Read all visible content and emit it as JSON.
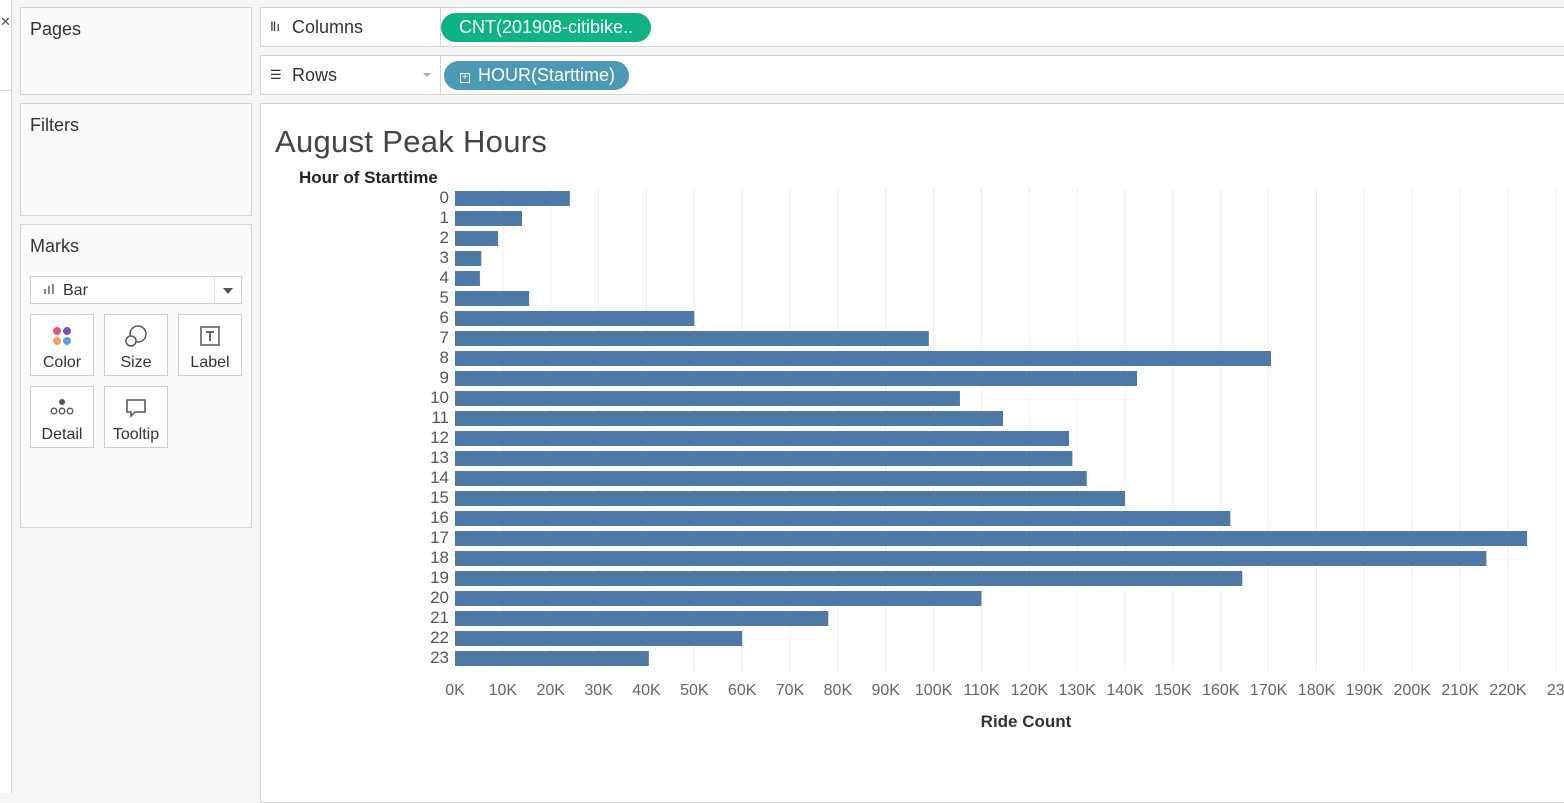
{
  "cards": {
    "pages": {
      "title": "Pages"
    },
    "filters": {
      "title": "Filters"
    },
    "marks": {
      "title": "Marks",
      "mark_type": "Bar",
      "buttons": [
        {
          "label": "Color",
          "icon": "color-icon"
        },
        {
          "label": "Size",
          "icon": "size-icon"
        },
        {
          "label": "Label",
          "icon": "label-icon"
        },
        {
          "label": "Detail",
          "icon": "detail-icon"
        },
        {
          "label": "Tooltip",
          "icon": "tooltip-icon"
        }
      ]
    }
  },
  "shelves": {
    "columns": {
      "label": "Columns",
      "pill": "CNT(201908-citibike..",
      "pill_color": "#0fb383"
    },
    "rows": {
      "label": "Rows",
      "pill": "HOUR(Starttime)",
      "pill_color": "#4b99b5"
    }
  },
  "chart_data": {
    "type": "bar",
    "orientation": "horizontal",
    "title": "August Peak Hours",
    "ylabel": "Hour of Starttime",
    "xlabel": "Ride Count",
    "categories": [
      "0",
      "1",
      "2",
      "3",
      "4",
      "5",
      "6",
      "7",
      "8",
      "9",
      "10",
      "11",
      "12",
      "13",
      "14",
      "15",
      "16",
      "17",
      "18",
      "19",
      "20",
      "21",
      "22",
      "23"
    ],
    "values": [
      24000,
      14000,
      9000,
      5500,
      5200,
      15500,
      50000,
      99000,
      170500,
      142500,
      105500,
      114500,
      128300,
      129000,
      132000,
      140000,
      162000,
      224000,
      215500,
      164500,
      110000,
      78000,
      60000,
      40500
    ],
    "xlim": [
      0,
      229000
    ],
    "xticks": [
      0,
      10000,
      20000,
      30000,
      40000,
      50000,
      60000,
      70000,
      80000,
      90000,
      100000,
      110000,
      120000,
      130000,
      140000,
      150000,
      160000,
      170000,
      180000,
      190000,
      200000,
      210000,
      220000,
      230000
    ],
    "xtick_labels": [
      "0K",
      "10K",
      "20K",
      "30K",
      "40K",
      "50K",
      "60K",
      "70K",
      "80K",
      "90K",
      "100K",
      "110K",
      "120K",
      "130K",
      "140K",
      "150K",
      "160K",
      "170K",
      "180K",
      "190K",
      "200K",
      "210K",
      "220K",
      "23"
    ],
    "bar_color": "#4e79a7",
    "grid": "vertical"
  }
}
